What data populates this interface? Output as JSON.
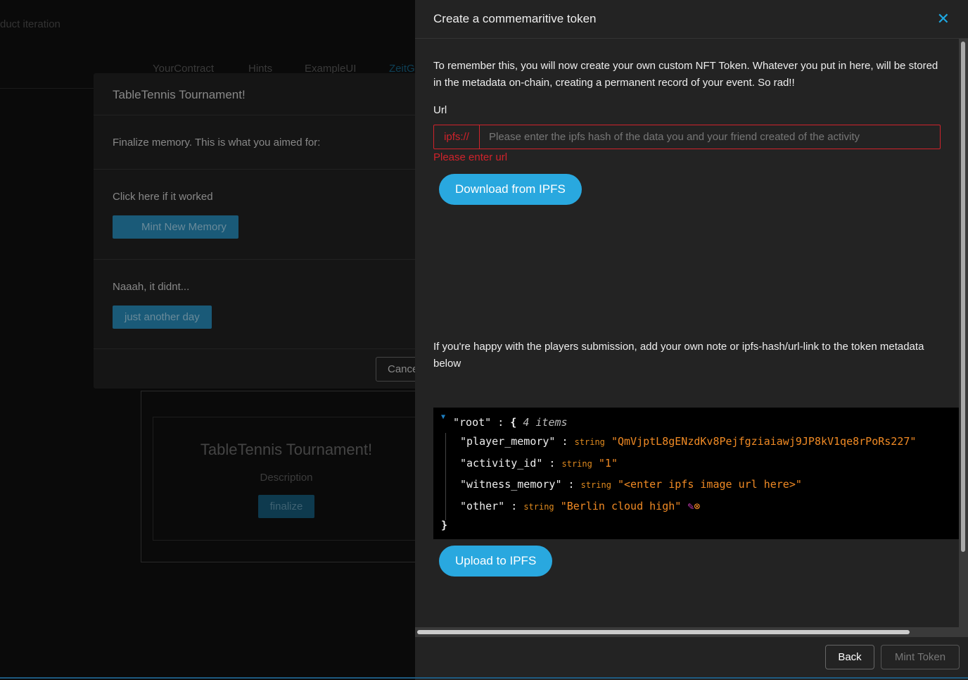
{
  "background": {
    "brand_text": "duct iteration",
    "nav": [
      "YourContract",
      "Hints",
      "ExampleUI",
      "ZeitG"
    ],
    "card": {
      "title": "TableTennis Tournament!",
      "description": "Description",
      "button": "finalize"
    }
  },
  "modal": {
    "title": "TableTennis Tournament!",
    "prompt": "Finalize memory. This is what you aimed for:",
    "worked_label": "Click here if it worked",
    "mint_button": "Mint New Memory",
    "failed_label": "Naaah, it didnt...",
    "failed_button": "just another day",
    "cancel_button": "Cancel"
  },
  "drawer": {
    "title": "Create a commemaritive token",
    "close_icon": "close-icon",
    "intro": "To remember this, you will now create your own custom NFT Token. Whatever you put in here, will be stored in the metadata on-chain, creating a permanent record of your event. So rad!!",
    "url_label": "Url",
    "url_prefix": "ipfs://",
    "url_value": "",
    "url_placeholder": "Please enter the ipfs hash of the data you and your friend created of the activity",
    "url_error": "Please enter url",
    "download_button": "Download from IPFS",
    "note": "If you're happy with the players submission, add your own note or ipfs-hash/url-link to the token metadata below",
    "json": {
      "root_key": "\"root\"",
      "count": "4 items",
      "type": "string",
      "entries": [
        {
          "key": "\"player_memory\"",
          "value": "\"QmVjptL8gENzdKv8Pejfgziaiawj9JP8kV1qe8rPoRs227\""
        },
        {
          "key": "\"activity_id\"",
          "value": "\"1\""
        },
        {
          "key": "\"witness_memory\"",
          "value": "\"<enter ipfs image url here>\""
        },
        {
          "key": "\"other\"",
          "value": "\"Berlin cloud high\""
        }
      ]
    },
    "upload_button": "Upload to IPFS",
    "back_button": "Back",
    "mint_button": "Mint Token"
  },
  "colors": {
    "accent": "#29a8df",
    "error": "#d0232b",
    "json_value": "#f08a24"
  }
}
